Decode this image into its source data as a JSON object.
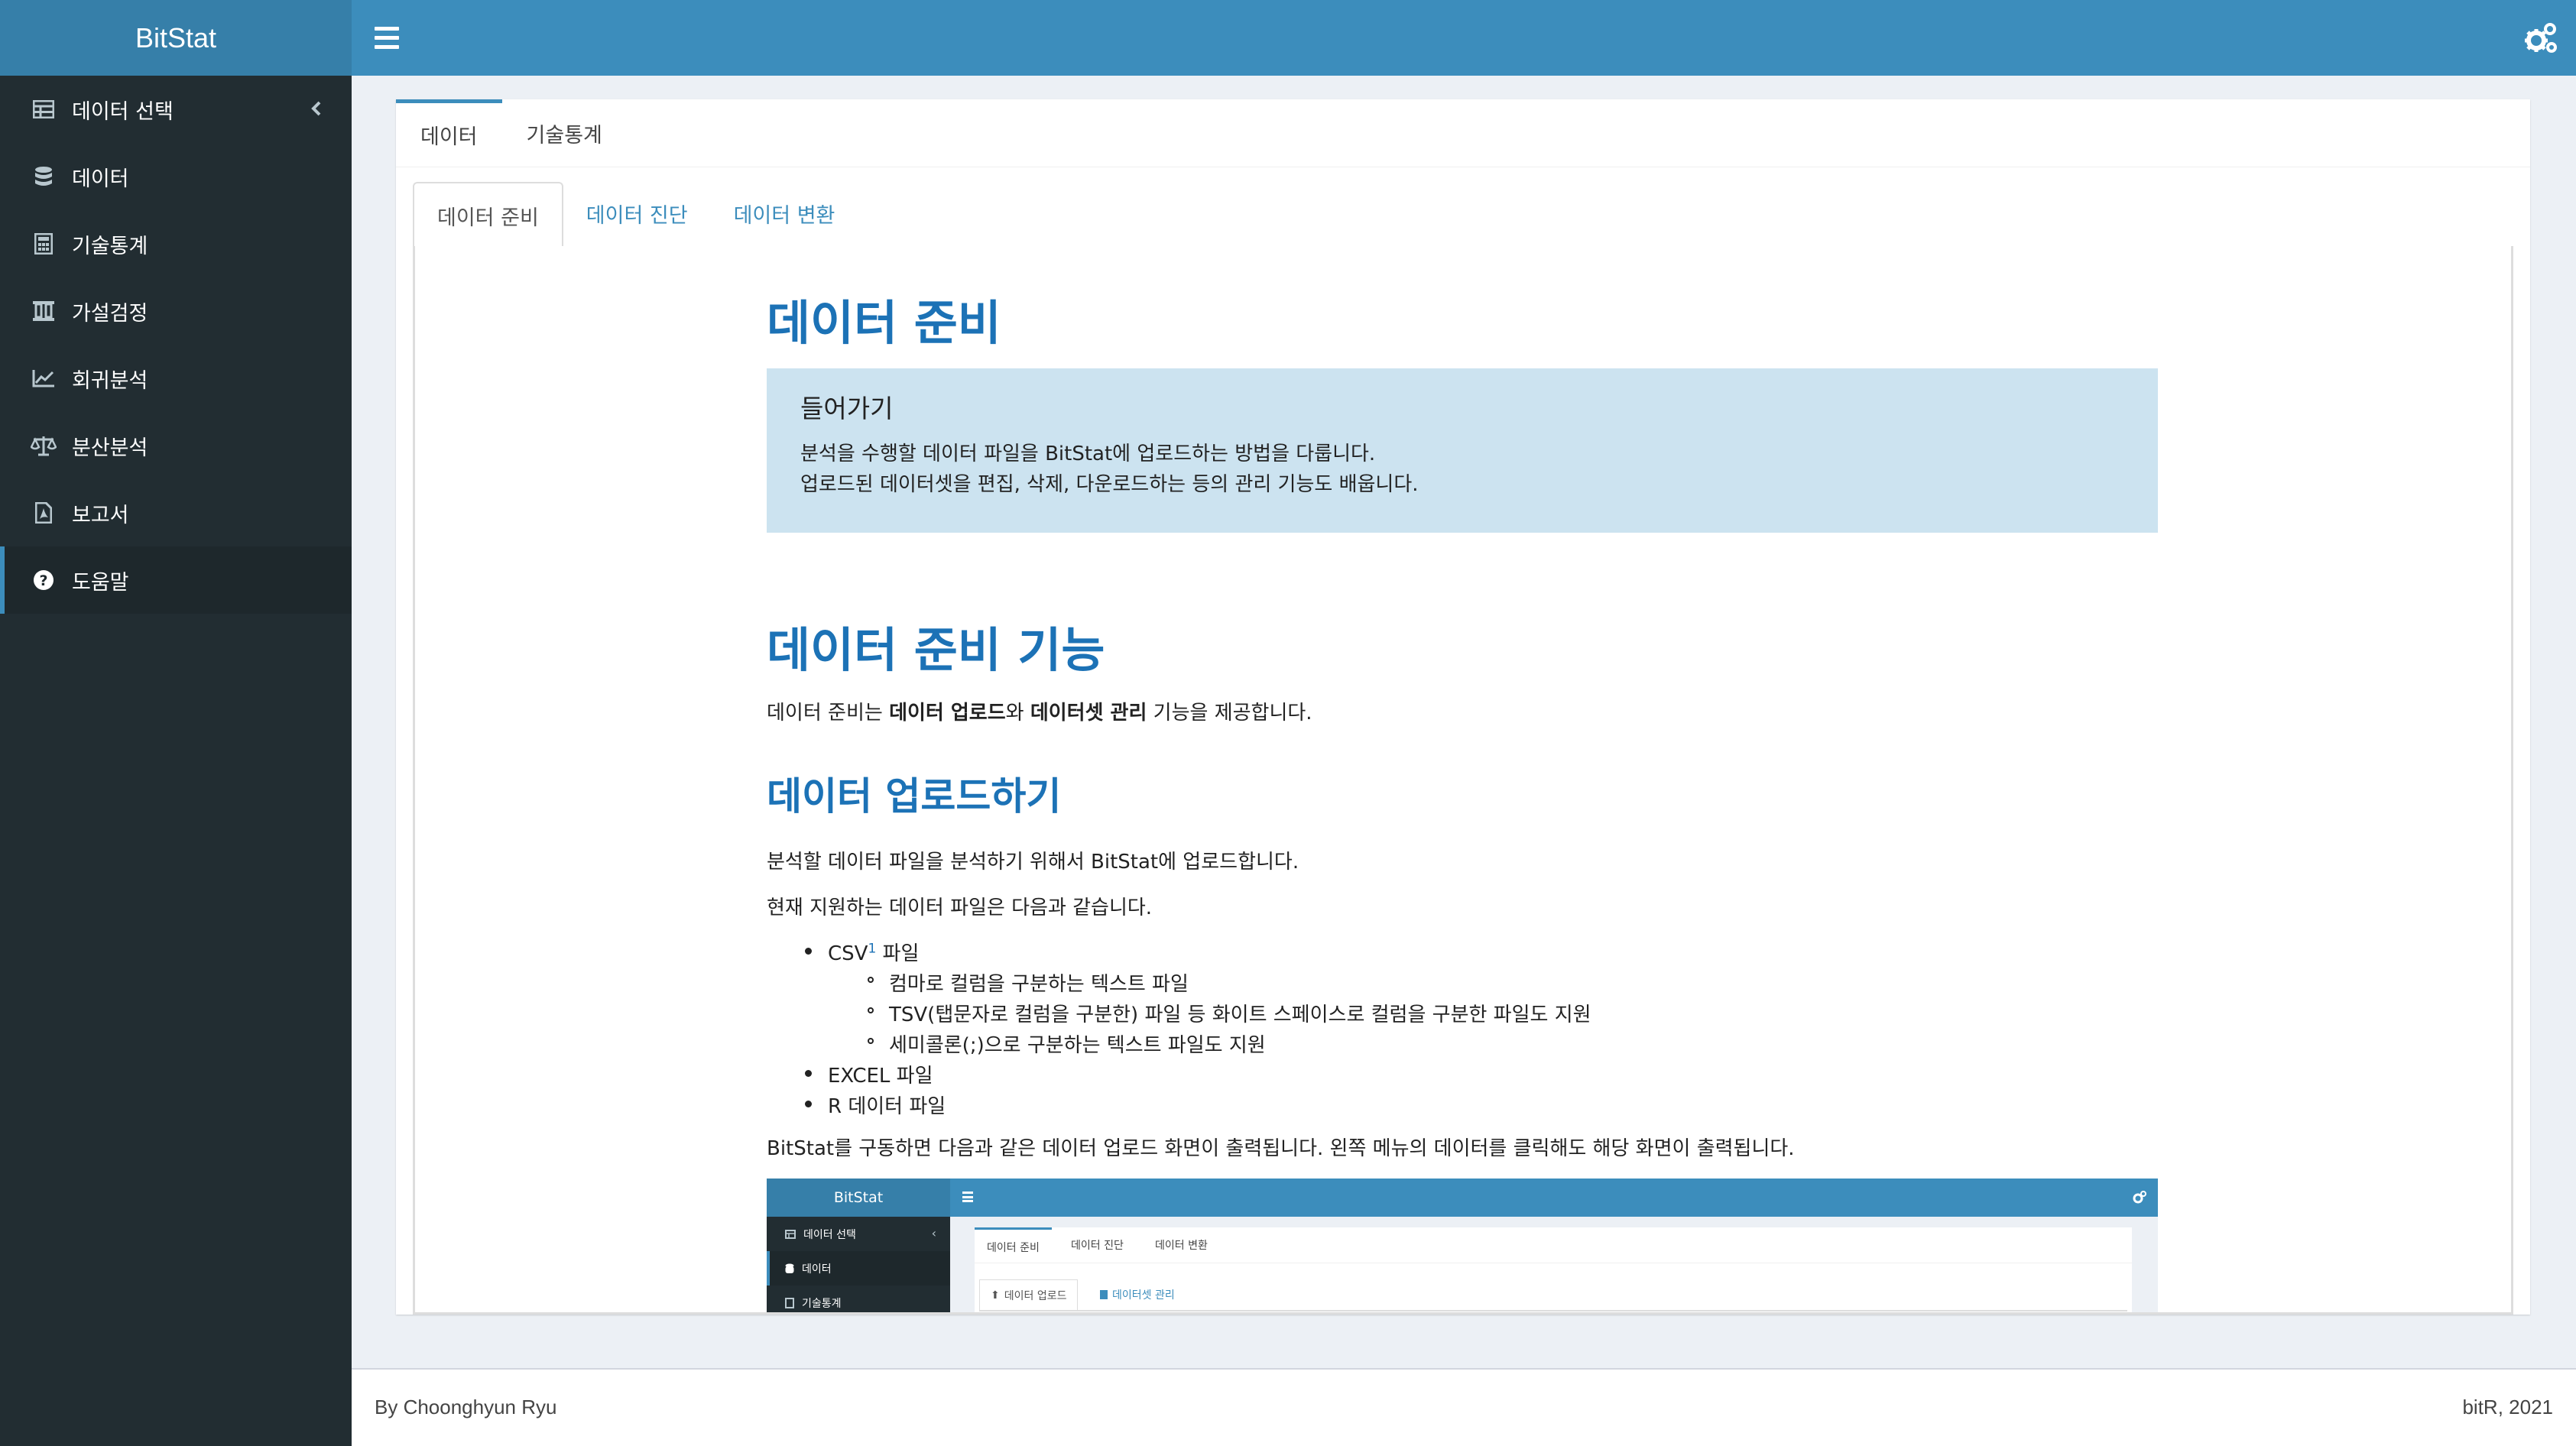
{
  "app": {
    "brand": "BitStat"
  },
  "sidebar": {
    "items": [
      {
        "label": "데이터 선택",
        "icon": "table-icon"
      },
      {
        "label": "데이터",
        "icon": "database-icon"
      },
      {
        "label": "기술통계",
        "icon": "calculator-icon"
      },
      {
        "label": "가설검정",
        "icon": "flask-icon"
      },
      {
        "label": "회귀분석",
        "icon": "line-chart-icon"
      },
      {
        "label": "분산분석",
        "icon": "balance-scale-icon"
      },
      {
        "label": "보고서",
        "icon": "file-pdf-icon"
      },
      {
        "label": "도움말",
        "icon": "question-circle-icon"
      }
    ],
    "active_index": 7
  },
  "main_tabs": [
    "데이터",
    "기술통계"
  ],
  "sub_tabs": [
    "데이터 준비",
    "데이터 진단",
    "데이터 변환"
  ],
  "doc": {
    "title": "데이터 준비",
    "intro": {
      "title": "들어가기",
      "line1": "분석을 수행할 데이터 파일을 BitStat에 업로드하는 방법을 다룹니다.",
      "line2": "업로드된 데이터셋을 편집, 삭제, 다운로드하는 등의 관리 기능도 배웁니다."
    },
    "section1": {
      "title": "데이터 준비 기능",
      "text_a": "데이터 준비는 ",
      "bold_a": "데이터 업로드",
      "text_b": "와 ",
      "bold_b": "데이터셋 관리",
      "text_c": " 기능을 제공합니다."
    },
    "section2": {
      "title": "데이터 업로드하기",
      "p1": "분석할 데이터 파일을 분석하기 위해서 BitStat에 업로드합니다.",
      "p2": "현재 지원하는 데이터 파일은 다음과 같습니다.",
      "list": {
        "csv": "CSV",
        "csv_sup": "1",
        "csv_suffix": " 파일",
        "csv_sub": [
          "컴마로 컬럼을 구분하는 텍스트 파일",
          "TSV(탭문자로 컬럼을 구분한) 파일 등 화이트 스페이스로 컬럼을 구분한 파일도 지원",
          "세미콜론(;)으로 구분하는 텍스트 파일도 지원"
        ],
        "excel": "EXCEL 파일",
        "r": "R 데이터 파일"
      },
      "p3": "BitStat를 구동하면 다음과 같은 데이터 업로드 화면이 출력됩니다. 왼쪽 메뉴의 데이터를 클릭해도 해당 화면이 출력됩니다."
    },
    "mini": {
      "brand": "BitStat",
      "nav": [
        "데이터 선택",
        "데이터",
        "기술통계"
      ],
      "tabs": [
        "데이터 준비",
        "데이터 진단",
        "데이터 변환"
      ],
      "btn_upload": "데이터 업로드",
      "btn_manage": "데이터셋 관리"
    }
  },
  "footer": {
    "left": "By Choonghyun Ryu",
    "right": "bitR, 2021"
  },
  "colors": {
    "header": "#3c8dbc",
    "brand": "#367fa9",
    "sidebar": "#222d32",
    "heading": "#1c72b6",
    "intro_bg": "#cce3f0"
  }
}
